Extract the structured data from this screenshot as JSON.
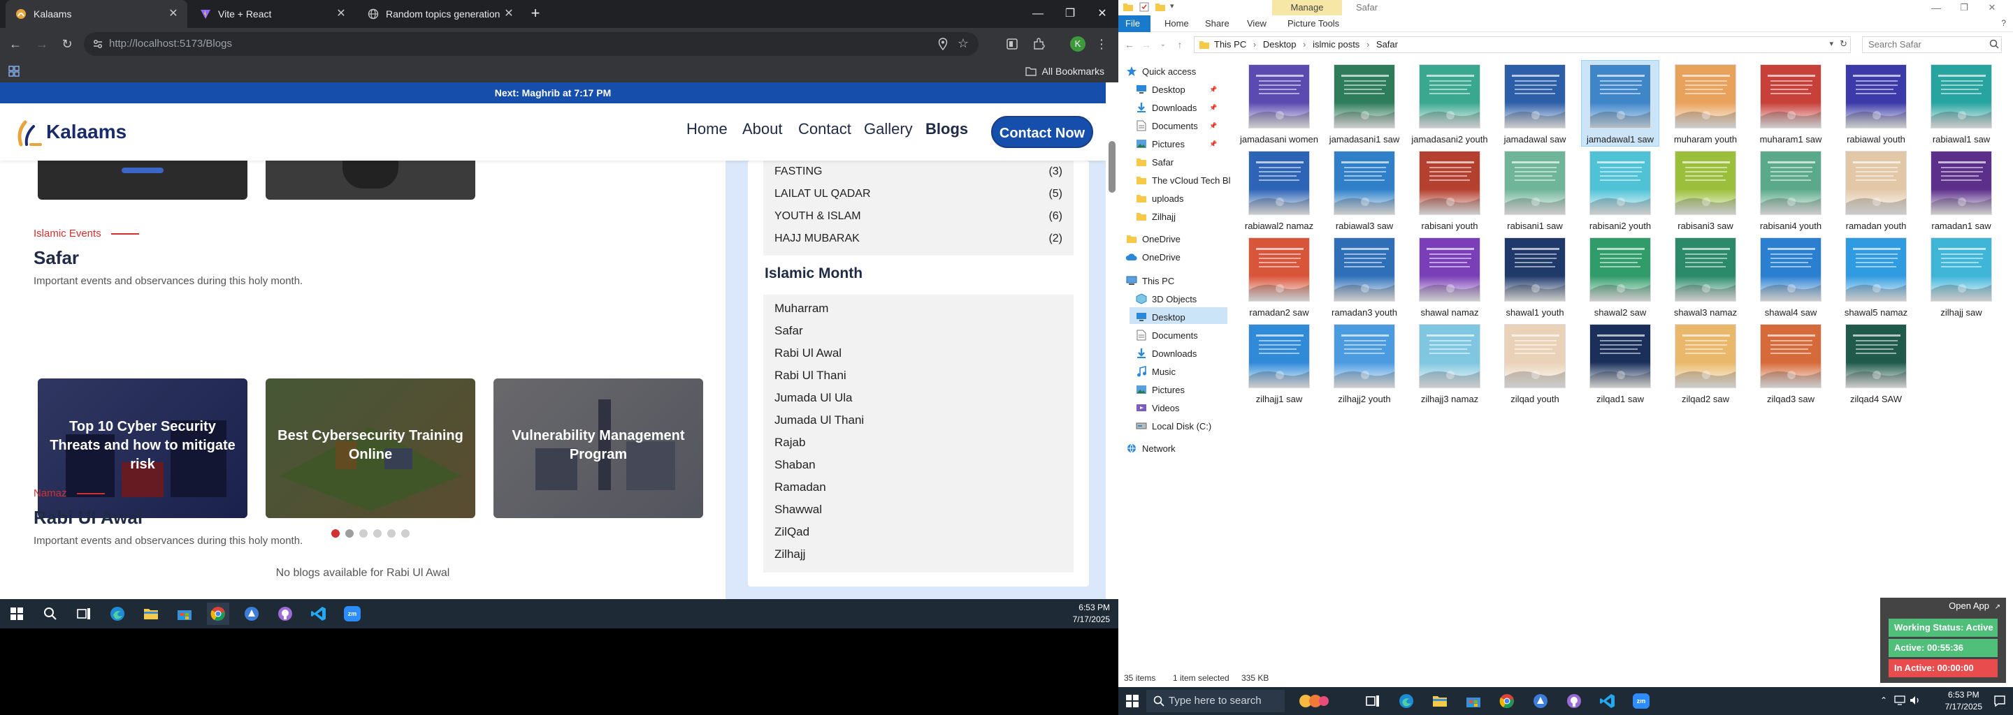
{
  "browser": {
    "tabs": [
      {
        "label": "Kalaams",
        "active": true
      },
      {
        "label": "Vite + React",
        "active": false
      },
      {
        "label": "Random topics generation",
        "active": false
      }
    ],
    "url": "http://localhost:5173/Blogs",
    "bookmarks_label": "All Bookmarks"
  },
  "site": {
    "prayer_text": "Next: Maghrib at 7:17 PM",
    "logo_text": "Kalaams",
    "nav": [
      "Home",
      "About",
      "Contact",
      "Gallery",
      "Blogs"
    ],
    "cta": "Contact Now",
    "sections": [
      {
        "eyebrow": "Islamic Events",
        "title": "Safar",
        "desc": "Important events and observances during this holy month."
      },
      {
        "eyebrow": "Namaz",
        "title": "Rabi Ul Awal",
        "desc": "Important events and observances during this holy month."
      }
    ],
    "cards": [
      "Top 10 Cyber Security Threats and how to mitigate risk",
      "Best Cybersecurity Training Online",
      "Vulnerability Management Program"
    ],
    "no_blogs": "No blogs available for Rabi Ul Awal",
    "categories": [
      {
        "name": "FASTING",
        "count": "(3)"
      },
      {
        "name": "LAILAT UL QADAR",
        "count": "(5)"
      },
      {
        "name": "YOUTH & ISLAM",
        "count": "(6)"
      },
      {
        "name": "HAJJ MUBARAK",
        "count": "(2)"
      }
    ],
    "month_heading": "Islamic Month",
    "months": [
      "Muharram",
      "Safar",
      "Rabi Ul Awal",
      "Rabi Ul Thani",
      "Jumada Ul Ula",
      "Jumada Ul Thani",
      "Rajab",
      "Shaban",
      "Ramadan",
      "Shawwal",
      "ZilQad",
      "Zilhajj"
    ]
  },
  "taskbar_left": {
    "time": "6:53 PM",
    "date": "7/17/2025"
  },
  "explorer": {
    "manage_label": "Manage",
    "window_title": "Safar",
    "ribbon_tabs": [
      "File",
      "Home",
      "Share",
      "View",
      "Picture Tools"
    ],
    "breadcrumb": [
      "This PC",
      "Desktop",
      "islmic posts",
      "Safar"
    ],
    "search_placeholder": "Search Safar",
    "nav_items": [
      {
        "label": "Quick access",
        "icon": "star-icon",
        "pinned": false
      },
      {
        "label": "Desktop",
        "icon": "desktop-icon",
        "pinned": true
      },
      {
        "label": "Downloads",
        "icon": "download-icon",
        "pinned": true
      },
      {
        "label": "Documents",
        "icon": "documents-icon",
        "pinned": true
      },
      {
        "label": "Pictures",
        "icon": "pictures-icon",
        "pinned": true
      },
      {
        "label": "Safar",
        "icon": "folder-icon",
        "pinned": false
      },
      {
        "label": "The vCloud Tech Bl",
        "icon": "folder-icon",
        "pinned": false
      },
      {
        "label": "uploads",
        "icon": "folder-icon",
        "pinned": false
      },
      {
        "label": "Zilhajj",
        "icon": "folder-icon",
        "pinned": false
      },
      {
        "label": "OneDrive",
        "icon": "folder-icon",
        "pinned": false
      },
      {
        "label": "OneDrive",
        "icon": "cloud-icon",
        "pinned": false
      },
      {
        "label": "This PC",
        "icon": "computer-icon",
        "pinned": false
      },
      {
        "label": "3D Objects",
        "icon": "cube-icon",
        "pinned": false
      },
      {
        "label": "Desktop",
        "icon": "desktop-icon",
        "pinned": false
      },
      {
        "label": "Documents",
        "icon": "documents-icon",
        "pinned": false
      },
      {
        "label": "Downloads",
        "icon": "download-icon",
        "pinned": false
      },
      {
        "label": "Music",
        "icon": "music-icon",
        "pinned": false
      },
      {
        "label": "Pictures",
        "icon": "pictures-icon",
        "pinned": false
      },
      {
        "label": "Videos",
        "icon": "videos-icon",
        "pinned": false
      },
      {
        "label": "Local Disk (C:)",
        "icon": "disk-icon",
        "pinned": false
      },
      {
        "label": "Network",
        "icon": "network-icon",
        "pinned": false
      }
    ],
    "files": [
      {
        "name": "jamadasani women",
        "color": "#5b4bb0"
      },
      {
        "name": "jamadasani1 saw",
        "color": "#2e7d5a"
      },
      {
        "name": "jamadasani2 youth",
        "color": "#3aa88f"
      },
      {
        "name": "jamadawal saw",
        "color": "#2d5fa8"
      },
      {
        "name": "jamadawal1 saw",
        "color": "#3f86c9"
      },
      {
        "name": "muharam youth",
        "color": "#e9a25c"
      },
      {
        "name": "muharam1 saw",
        "color": "#c8403a"
      },
      {
        "name": "rabiawal youth",
        "color": "#3c3aa8"
      },
      {
        "name": "rabiawal1 saw",
        "color": "#27a3a0"
      },
      {
        "name": "rabiawal2 namaz",
        "color": "#2e64b5"
      },
      {
        "name": "rabiawal3 saw",
        "color": "#2f80c8"
      },
      {
        "name": "rabisani youth",
        "color": "#b4402f"
      },
      {
        "name": "rabisani1 saw",
        "color": "#6fb59a"
      },
      {
        "name": "rabisani2 youth",
        "color": "#4fc2d6"
      },
      {
        "name": "rabisani3 saw",
        "color": "#9bbf3a"
      },
      {
        "name": "rabisani4 youth",
        "color": "#5aa98a"
      },
      {
        "name": "ramadan youth",
        "color": "#e3c8a8"
      },
      {
        "name": "ramadan1 saw",
        "color": "#5c2f8a"
      },
      {
        "name": "ramadan2 saw",
        "color": "#d9553a"
      },
      {
        "name": "ramadan3 youth",
        "color": "#2e6fb8"
      },
      {
        "name": "shawal namaz",
        "color": "#7a3fb8"
      },
      {
        "name": "shawal1 youth",
        "color": "#1f3a6a"
      },
      {
        "name": "shawal2 saw",
        "color": "#2f9c6a"
      },
      {
        "name": "shawal3 namaz",
        "color": "#2a8a6a"
      },
      {
        "name": "shawal4 saw",
        "color": "#2a7fd0"
      },
      {
        "name": "shawal5 namaz",
        "color": "#2f9be0"
      },
      {
        "name": "zilhajj saw",
        "color": "#3fb5d8"
      },
      {
        "name": "zilhajj1 saw",
        "color": "#2f8ad8"
      },
      {
        "name": "zilhajj2 youth",
        "color": "#4a9be0"
      },
      {
        "name": "zilhajj3 namaz",
        "color": "#7fc6e0"
      },
      {
        "name": "zilqad youth",
        "color": "#e9d2b8"
      },
      {
        "name": "zilqad1 saw",
        "color": "#1a2f5a"
      },
      {
        "name": "zilqad2 saw",
        "color": "#e9b86a"
      },
      {
        "name": "zilqad3 saw",
        "color": "#d66a3a"
      },
      {
        "name": "zilqad4 SAW",
        "color": "#1f5a4a"
      }
    ],
    "selected_file_index": 4,
    "status": {
      "items": "35 items",
      "selected": "1 item selected",
      "size": "335 KB"
    }
  },
  "widget": {
    "open_app": "Open App",
    "working_status": "Working Status: Active",
    "active_time": "Active: 00:55:36",
    "inactive_time": "In Active: 00:00:00"
  },
  "taskbar_right": {
    "search_placeholder": "Type here to search",
    "time": "6:53 PM",
    "date": "7/17/2025"
  },
  "colors": {
    "brand_blue": "#154eab",
    "accent_red": "#d32f2f",
    "status_green": "#4fbf7a",
    "status_red": "#e84c4c",
    "explorer_select": "#cce4f7"
  }
}
